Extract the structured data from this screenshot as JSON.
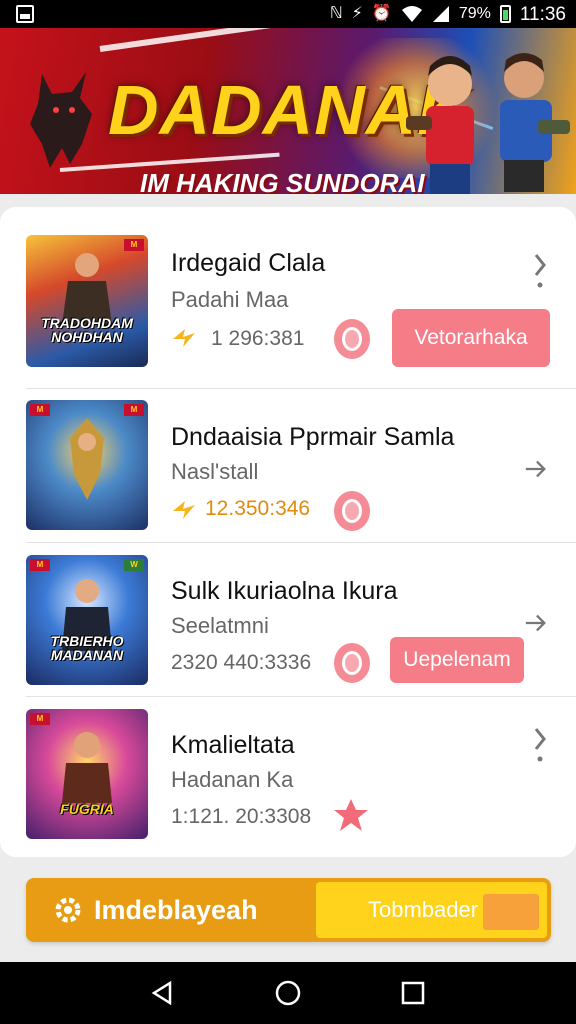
{
  "status_bar": {
    "battery_text": "79%",
    "time": "11:36",
    "icons": [
      "notification-icon",
      "nfc-icon",
      "vibrate-icon",
      "alarm-icon",
      "wifi-icon",
      "signal-icon",
      "battery-icon"
    ]
  },
  "banner": {
    "title": "DADANAK",
    "subtitle": "IM HAKING SUNDORAI"
  },
  "games": [
    {
      "title": "Irdegaid Clala",
      "subtitle": "Padahi Maa",
      "stat": "1 296:381",
      "action_label": "Vetorarhaka",
      "thumb_caption": "TRADOHDAM NOHDHAN",
      "chevron": "more-vert"
    },
    {
      "title": "Dndaaisia Pprmair Samla",
      "subtitle": "Nasl'stall",
      "stat": "12.350:346",
      "action_label": "",
      "thumb_caption": "",
      "chevron": "arrow-right"
    },
    {
      "title": "Sulk Ikuriaolna Ikura",
      "subtitle": "Seelatmni",
      "stat": "2320 440:3336",
      "action_label": "Uepelenam",
      "thumb_caption": "TRBIERHO MADANAN",
      "chevron": "arrow-right"
    },
    {
      "title": "Kmalieltata",
      "subtitle": "Hadanan Ka",
      "stat": "1:121. 20:3308",
      "action_label": "",
      "thumb_caption": "FUGRIA",
      "chevron": "more-vert"
    }
  ],
  "action_bar": {
    "primary_label": "Imdeblayeah",
    "secondary_label": "Tobmbader"
  },
  "colors": {
    "accent_pink": "#f47d88",
    "accent_orange": "#e79c14",
    "accent_yellow": "#ffd21c"
  }
}
